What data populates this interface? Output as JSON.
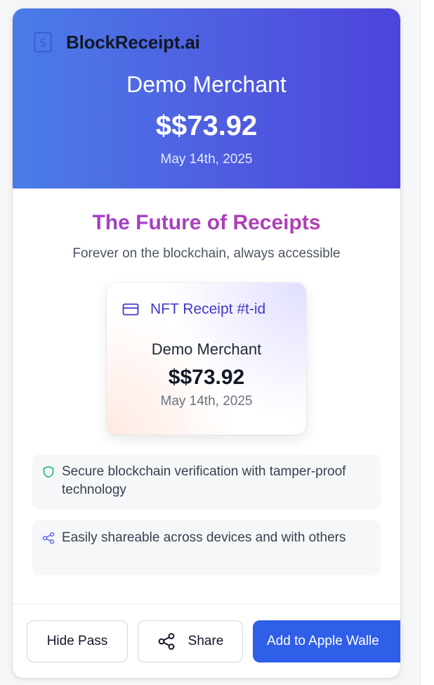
{
  "brand": {
    "name": "BlockReceipt.ai",
    "icon": "dollar-receipt-icon"
  },
  "header": {
    "merchant": "Demo Merchant",
    "amount": "$$73.92",
    "date": "May 14th, 2025"
  },
  "promo": {
    "title": "The Future of Receipts",
    "subtitle": "Forever on the blockchain, always accessible"
  },
  "nft": {
    "label": "NFT Receipt #t-id",
    "icon": "credit-card-icon",
    "merchant": "Demo Merchant",
    "amount": "$$73.92",
    "date": "May 14th, 2025"
  },
  "features": [
    {
      "icon": "shield-icon",
      "text": "Secure blockchain verification with tamper-proof technology"
    },
    {
      "icon": "share-icon",
      "text": "Easily shareable across devices and with others"
    }
  ],
  "actions": {
    "hide": "Hide Pass",
    "share": "Share",
    "wallet": "Add to Apple Walle"
  },
  "colors": {
    "header_gradient_start": "#4a7de8",
    "header_gradient_end": "#4d44dc",
    "title_gradient_start": "#9b3fd0",
    "title_gradient_end": "#b83fa8",
    "nft_accent": "#4338ca",
    "primary_button": "#2f5ee8",
    "shield_green": "#10b981",
    "share_indigo": "#6366f1"
  }
}
